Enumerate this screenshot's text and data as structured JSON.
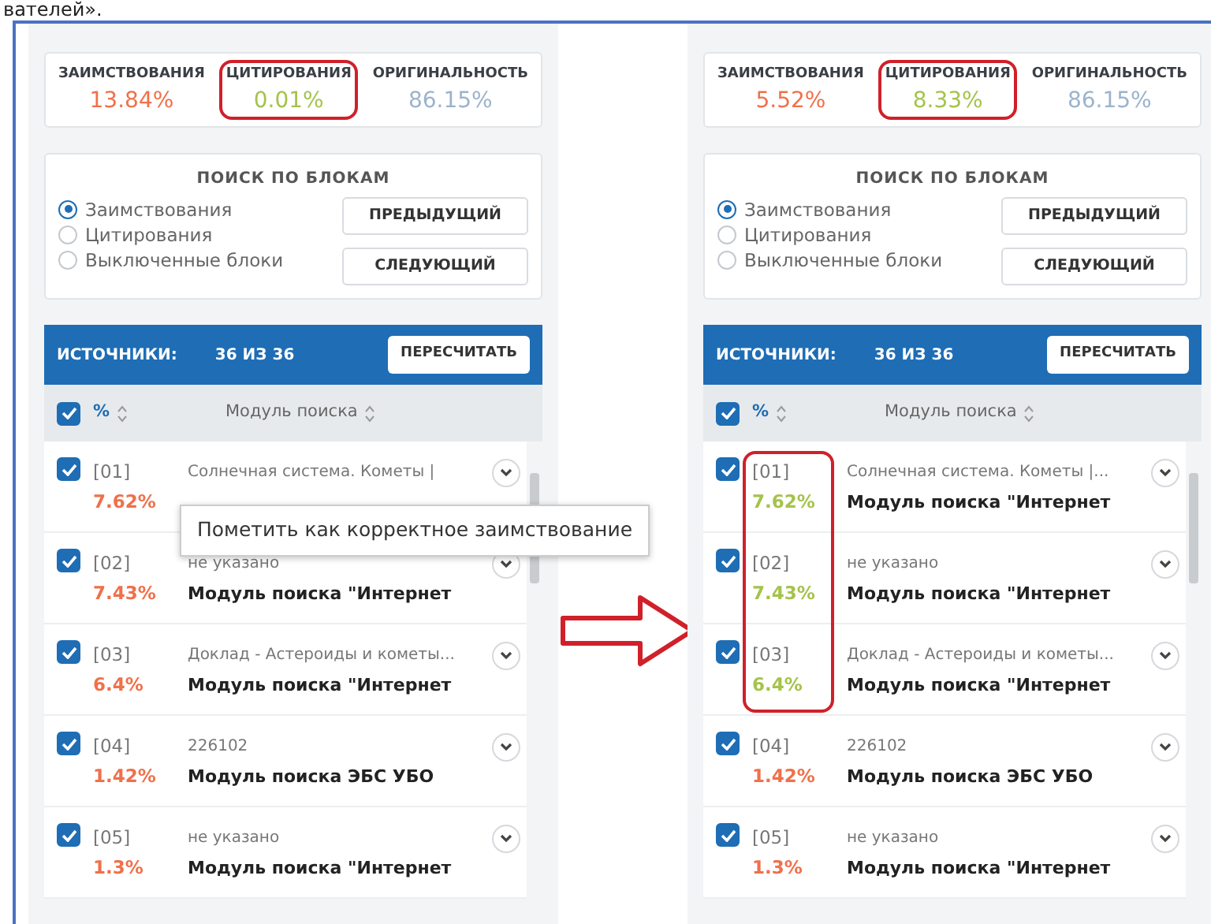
{
  "caption": "вателей».",
  "panels": [
    {
      "stats": [
        {
          "kind": "borrow",
          "label": "ЗАИМСТВОВАНИЯ",
          "value": "13.84%",
          "highlighted": false
        },
        {
          "kind": "citation",
          "label": "ЦИТИРОВАНИЯ",
          "value": "0.01%",
          "highlighted": true
        },
        {
          "kind": "original",
          "label": "ОРИГИНАЛЬНОСТЬ",
          "value": "86.15%",
          "highlighted": false
        }
      ],
      "block_search": {
        "title": "ПОИСК ПО БЛОКАМ",
        "options": [
          {
            "label": "Заимствования",
            "selected": true
          },
          {
            "label": "Цитирования",
            "selected": false
          },
          {
            "label": "Выключенные блоки",
            "selected": false
          }
        ],
        "buttons": [
          "ПРЕДЫДУЩИЙ",
          "СЛЕДУЮЩИЙ"
        ]
      },
      "sources": {
        "title": "ИСТОЧНИКИ:",
        "count": "36 ИЗ 36",
        "button": "ПЕРЕСЧИТАТЬ",
        "header_checked": true,
        "columns": [
          "%",
          "Модуль поиска"
        ],
        "rows": [
          {
            "checked": true,
            "index": "[01]",
            "percent": "7.62%",
            "color": "#f0704a",
            "title": "Солнечная система. Кометы |",
            "highlighted": false
          },
          {
            "checked": true,
            "index": "[02]",
            "percent": "7.43%",
            "color": "#f0704a",
            "title": "не указано",
            "module": "Модуль поиска \"Интернет",
            "highlighted": false
          },
          {
            "checked": true,
            "index": "[03]",
            "percent": "6.4%",
            "color": "#f0704a",
            "title": "Доклад - Астероиды и кометы...",
            "module": "Модуль поиска \"Интернет",
            "highlighted": false
          },
          {
            "checked": true,
            "index": "[04]",
            "percent": "1.42%",
            "color": "#f0704a",
            "title": "226102",
            "module": "Модуль поиска ЭБС УБО",
            "highlighted": false
          },
          {
            "checked": true,
            "index": "[05]",
            "percent": "1.3%",
            "color": "#f0704a",
            "title": "не указано",
            "module": "Модуль поиска \"Интернет",
            "highlighted": false
          }
        ]
      },
      "tooltip": "Пометить как корректное заимствование"
    },
    {
      "stats": [
        {
          "kind": "borrow",
          "label": "ЗАИМСТВОВАНИЯ",
          "value": "5.52%",
          "highlighted": false
        },
        {
          "kind": "citation",
          "label": "ЦИТИРОВАНИЯ",
          "value": "8.33%",
          "highlighted": true
        },
        {
          "kind": "original",
          "label": "ОРИГИНАЛЬНОСТЬ",
          "value": "86.15%",
          "highlighted": false
        }
      ],
      "block_search": {
        "title": "ПОИСК ПО БЛОКАМ",
        "options": [
          {
            "label": "Заимствования",
            "selected": true
          },
          {
            "label": "Цитирования",
            "selected": false
          },
          {
            "label": "Выключенные блоки",
            "selected": false
          }
        ],
        "buttons": [
          "ПРЕДЫДУЩИЙ",
          "СЛЕДУЮЩИЙ"
        ]
      },
      "sources": {
        "title": "ИСТОЧНИКИ:",
        "count": "36 ИЗ 36",
        "button": "ПЕРЕСЧИТАТЬ",
        "header_checked": true,
        "columns": [
          "%",
          "Модуль поиска"
        ],
        "rows": [
          {
            "checked": true,
            "index": "[01]",
            "percent": "7.62%",
            "color": "#a5c34a",
            "title": "Солнечная система. Кометы |...",
            "module": "Модуль поиска \"Интернет",
            "highlighted": true
          },
          {
            "checked": true,
            "index": "[02]",
            "percent": "7.43%",
            "color": "#a5c34a",
            "title": "не указано",
            "module": "Модуль поиска \"Интернет",
            "highlighted": true
          },
          {
            "checked": true,
            "index": "[03]",
            "percent": "6.4%",
            "color": "#a5c34a",
            "title": "Доклад - Астероиды и кометы...",
            "module": "Модуль поиска \"Интернет",
            "highlighted": true
          },
          {
            "checked": true,
            "index": "[04]",
            "percent": "1.42%",
            "color": "#f0704a",
            "title": "226102",
            "module": "Модуль поиска ЭБС УБО",
            "highlighted": false
          },
          {
            "checked": true,
            "index": "[05]",
            "percent": "1.3%",
            "color": "#f0704a",
            "title": "не указано",
            "module": "Модуль поиска \"Интернет",
            "highlighted": false
          }
        ]
      }
    }
  ]
}
